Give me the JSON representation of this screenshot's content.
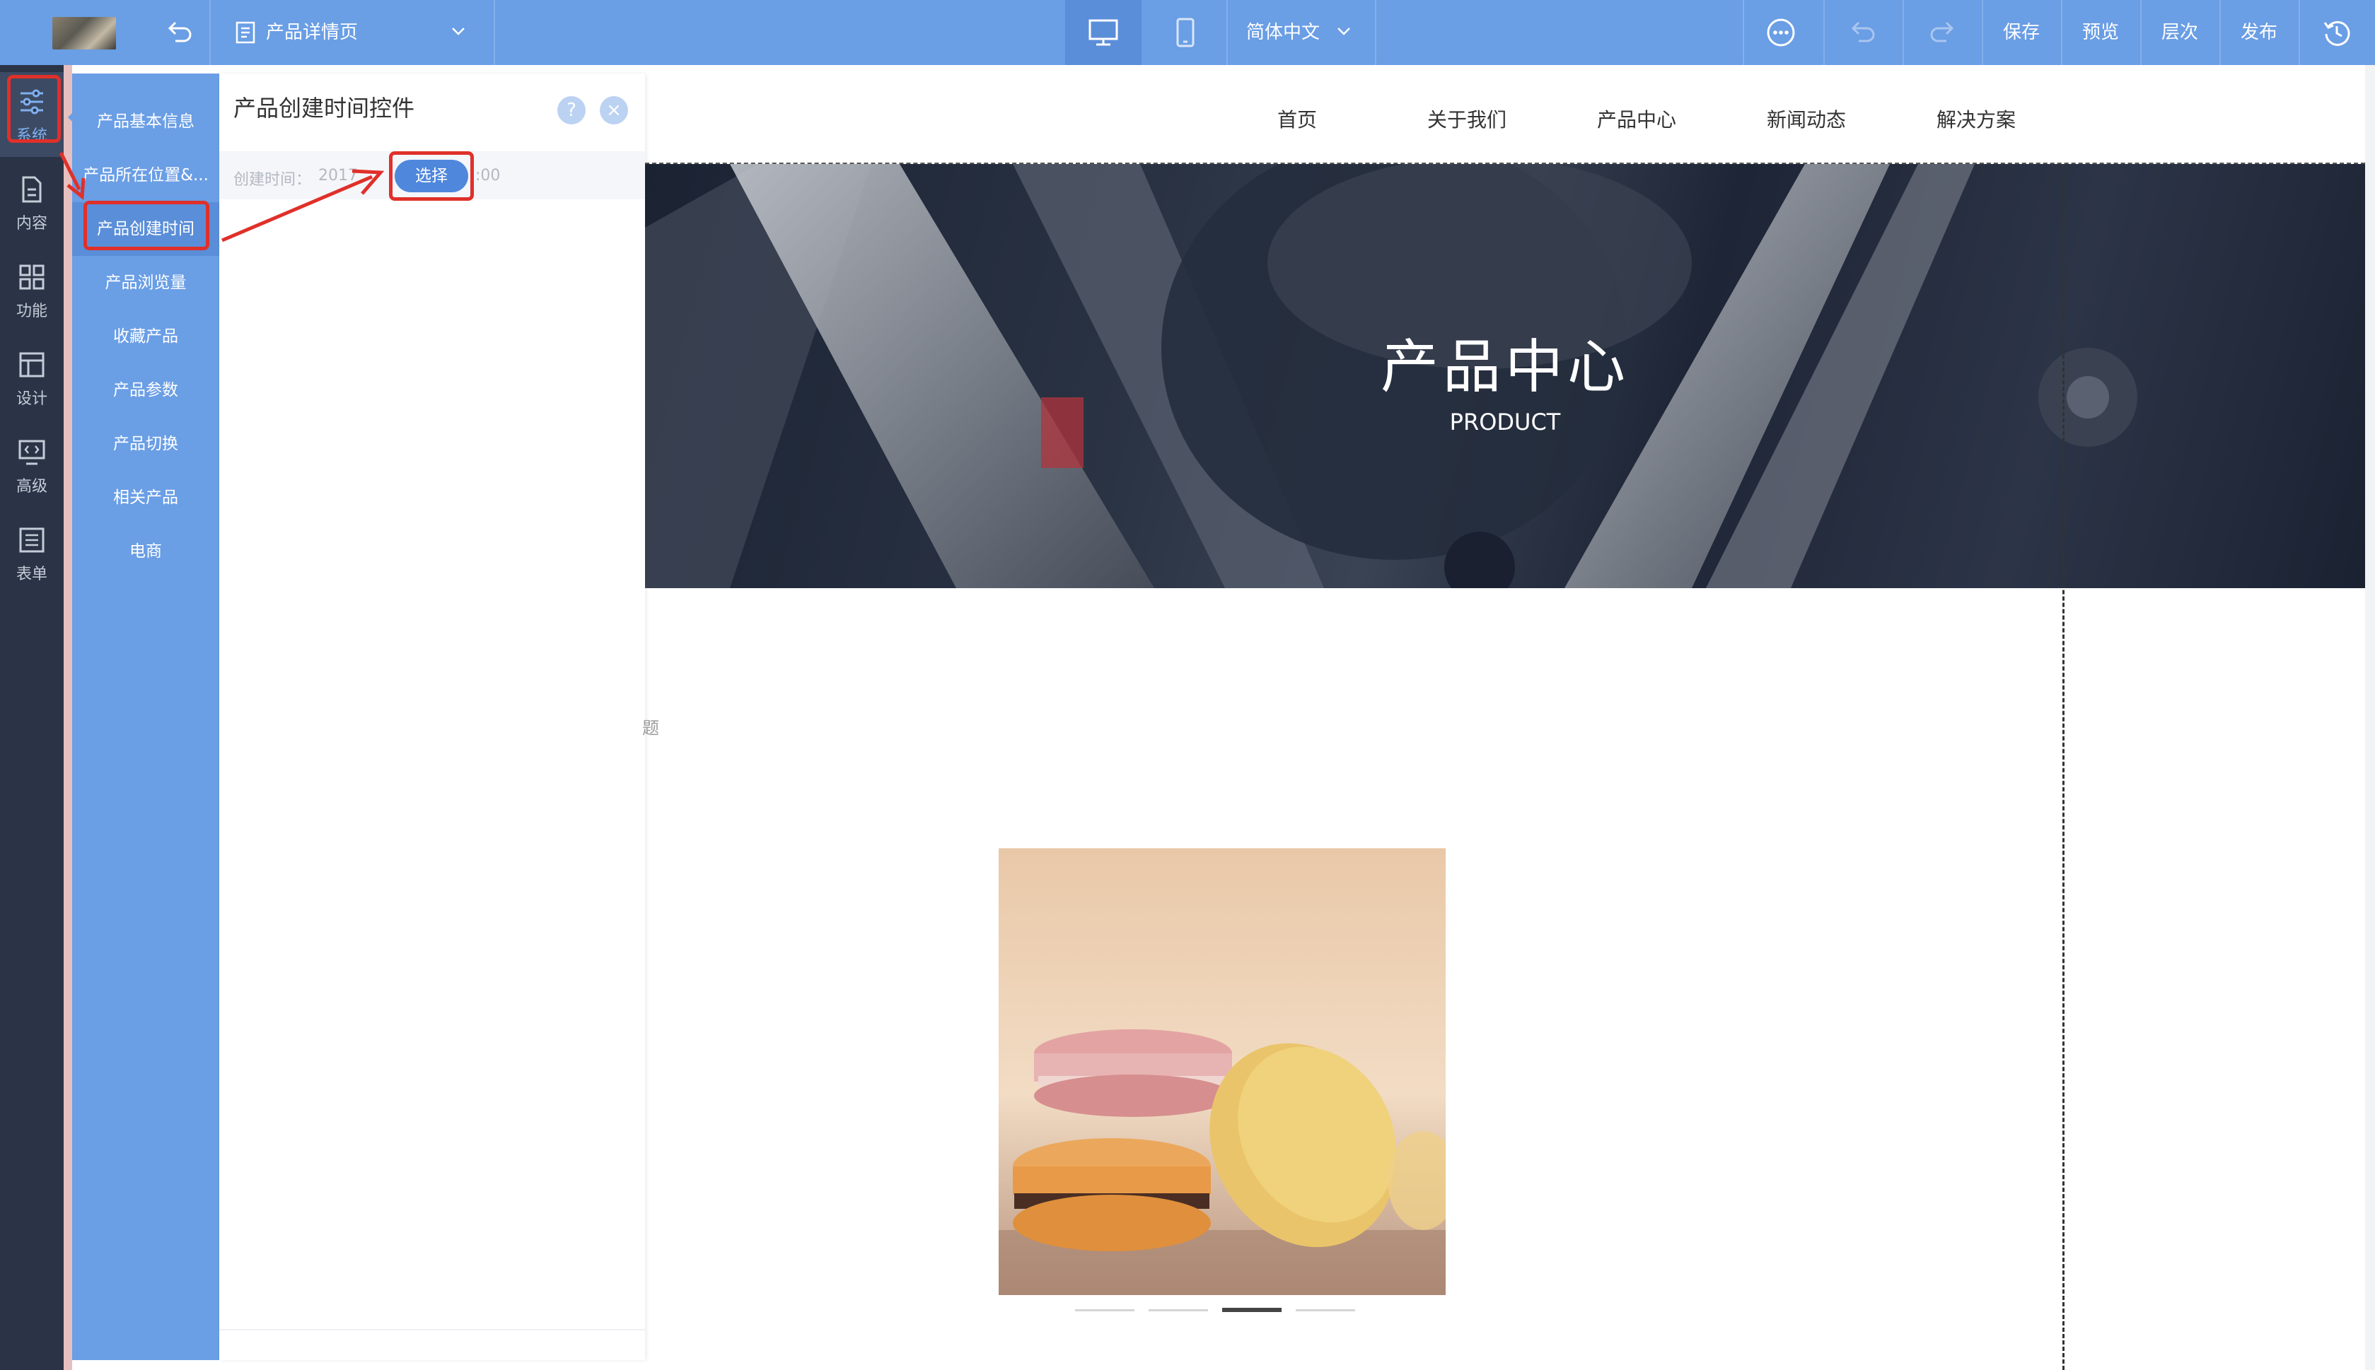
{
  "topbar": {
    "page_selector": "产品详情页",
    "language": "简体中文",
    "actions": [
      "保存",
      "预览",
      "层次",
      "发布"
    ]
  },
  "rail": {
    "items": [
      {
        "label": "系统",
        "icon": "sliders-icon"
      },
      {
        "label": "内容",
        "icon": "document-icon"
      },
      {
        "label": "功能",
        "icon": "grid-icon"
      },
      {
        "label": "设计",
        "icon": "layout-icon"
      },
      {
        "label": "高级",
        "icon": "code-monitor-icon"
      },
      {
        "label": "表单",
        "icon": "list-form-icon"
      }
    ]
  },
  "submenu": {
    "items": [
      "产品基本信息",
      "产品所在位置&...",
      "产品创建时间",
      "产品浏览量",
      "收藏产品",
      "产品参数",
      "产品切换",
      "相关产品",
      "电商"
    ],
    "active_index": 2
  },
  "panel": {
    "title": "产品创建时间控件",
    "help": "?",
    "close": "×",
    "field_label": "创建时间：",
    "field_value_left": "2017",
    "field_value_right": ":00",
    "choose_button": "选择"
  },
  "site": {
    "nav": [
      "首页",
      "关于我们",
      "产品中心",
      "新闻动态",
      "解决方案"
    ],
    "banner_title": "产品中心",
    "banner_subtitle": "PRODUCT",
    "fragment": "题",
    "slider_count": 4,
    "slider_active": 2
  },
  "colors": {
    "accent": "#6a9ee5",
    "rail": "#2b3446",
    "highlight": "#e0302a",
    "button": "#4f87dc"
  }
}
